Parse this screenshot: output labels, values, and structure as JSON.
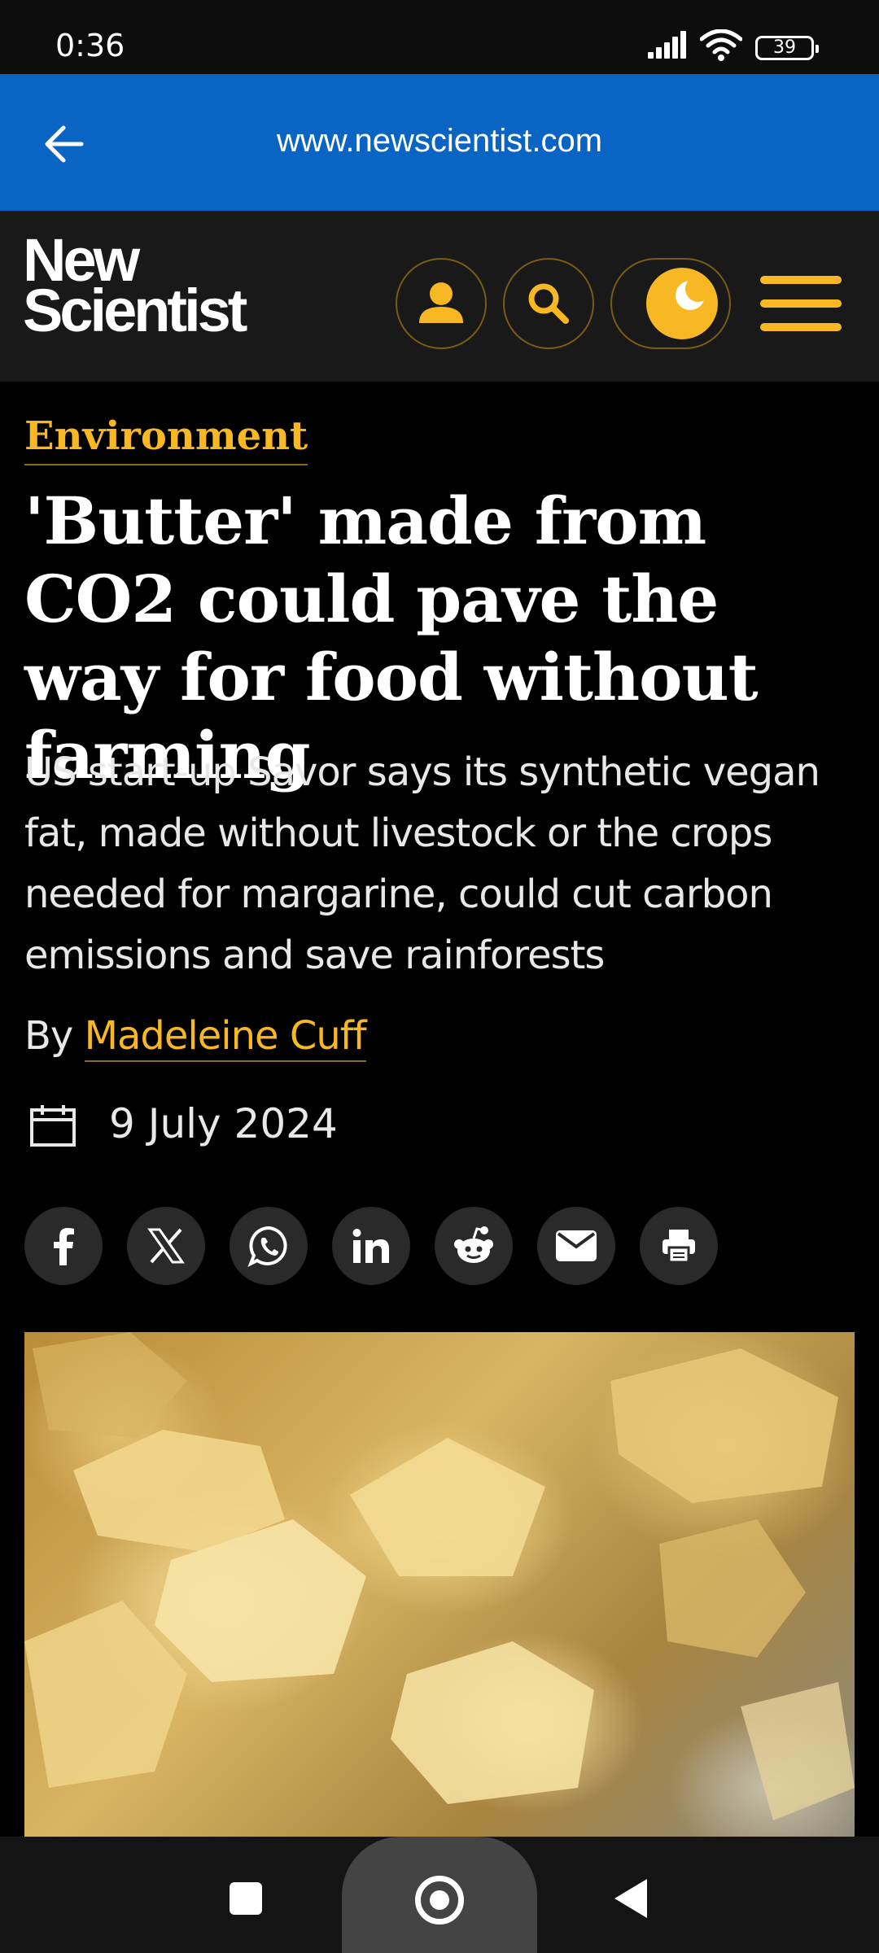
{
  "status_bar": {
    "time": "0:36",
    "battery": "39"
  },
  "browser": {
    "url": "www.newscientist.com",
    "back_icon": "arrow-left-icon"
  },
  "site": {
    "logo_line1": "New",
    "logo_line2": "Scientist",
    "accent_color": "#f7b824",
    "header_buttons": [
      "account-icon",
      "search-icon",
      "moon-icon",
      "menu-icon"
    ]
  },
  "article": {
    "category": "Environment",
    "headline": "'Butter' made from CO2 could pave the way for food without farming",
    "standfirst": "US start-up Savor says its synthetic vegan fat, made without livestock or the crops needed for margarine, could cut carbon emissions and save rainforests",
    "byline_prefix": "By ",
    "author": "Madeleine Cuff",
    "date": "9 July 2024",
    "share_buttons": [
      "facebook-icon",
      "x-icon",
      "whatsapp-icon",
      "linkedin-icon",
      "reddit-icon",
      "email-icon",
      "print-icon"
    ]
  },
  "navigation": {
    "buttons": [
      "recents-button",
      "home-button",
      "back-button"
    ]
  }
}
